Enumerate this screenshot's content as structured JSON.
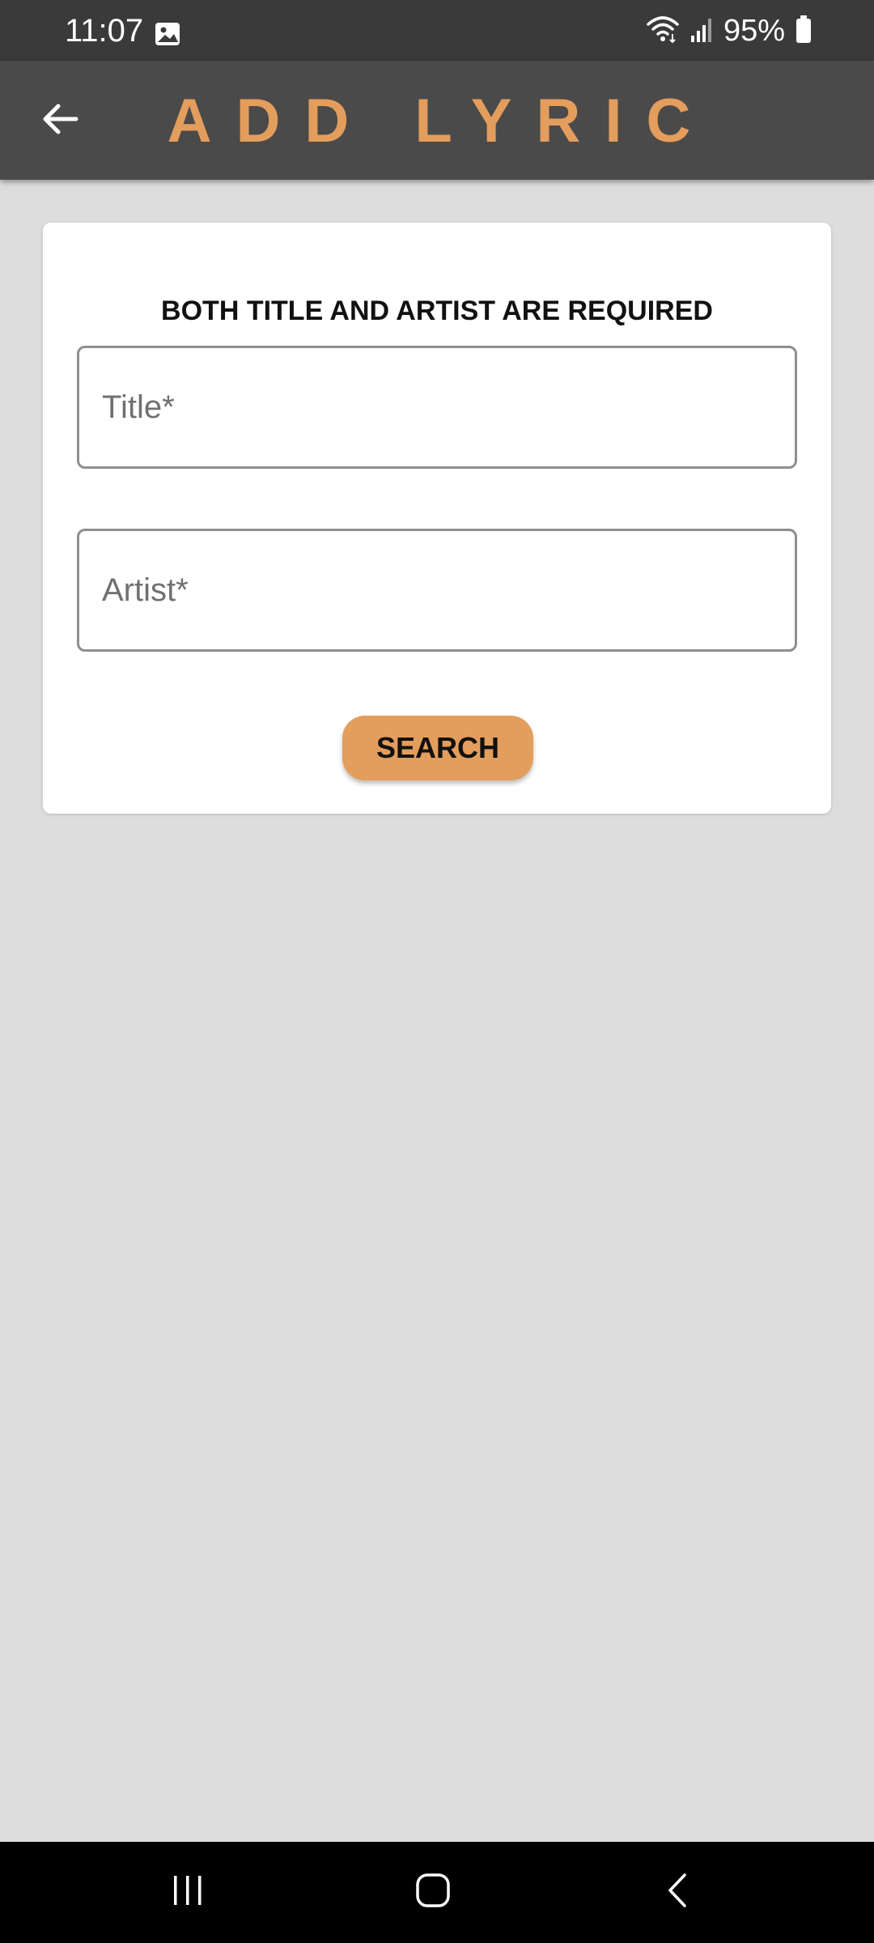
{
  "status_bar": {
    "time": "11:07",
    "battery": "95%",
    "icons": [
      "gallery-icon",
      "wifi-icon",
      "signal-icon",
      "battery-icon"
    ]
  },
  "app_bar": {
    "title": "ADD LYRIC",
    "back_icon": "arrow-left-icon",
    "background": "#4a4a4a",
    "accent": "#e39d5c"
  },
  "form": {
    "heading": "BOTH TITLE AND ARTIST ARE REQUIRED",
    "title_field": {
      "value": "",
      "placeholder": "Title*"
    },
    "artist_field": {
      "value": "",
      "placeholder": "Artist*"
    },
    "search_label": "SEARCH"
  },
  "nav_bar": {
    "icons": [
      "recents-icon",
      "home-icon",
      "back-icon"
    ]
  },
  "colors": {
    "page_background": "#dddddd",
    "card_background": "#ffffff",
    "button": "#e39d5c"
  }
}
